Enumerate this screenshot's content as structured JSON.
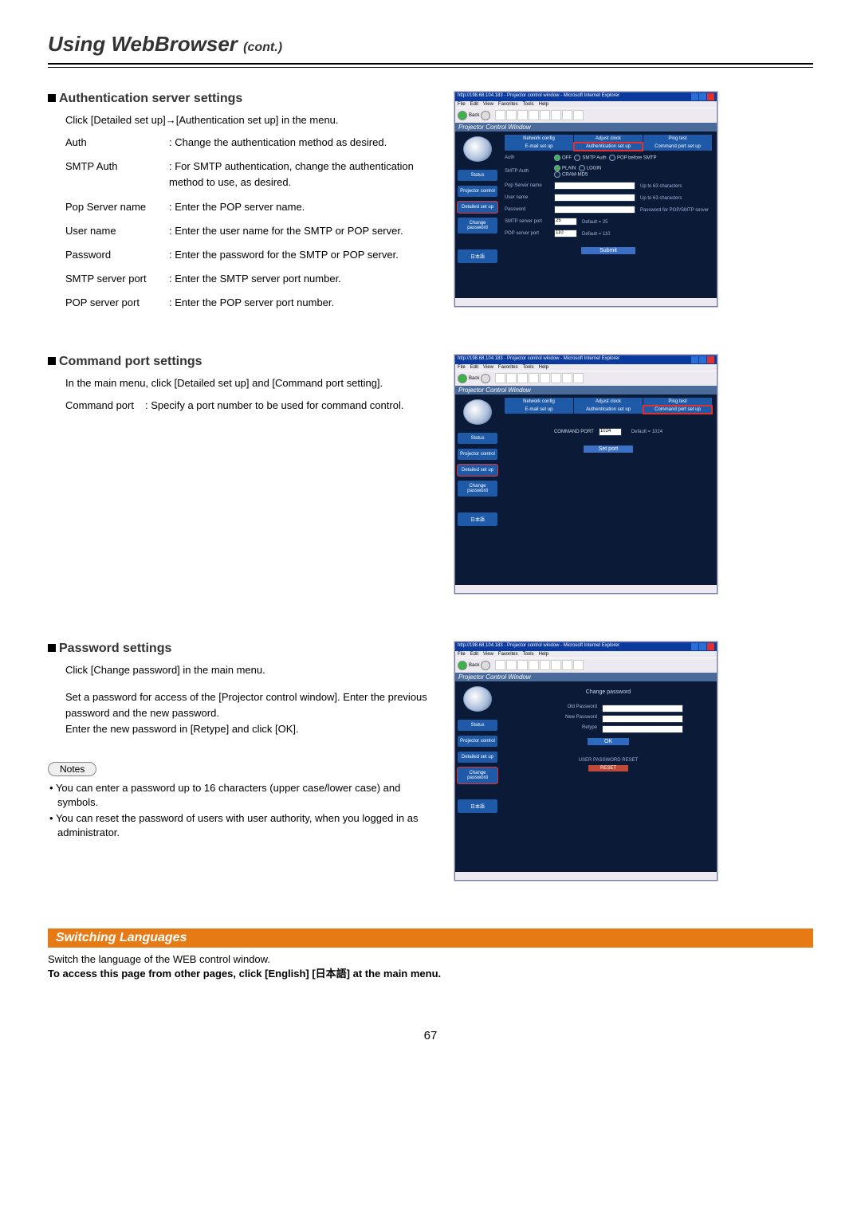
{
  "title": "Using WebBrowser",
  "title_cont": "(cont.)",
  "pagenum": "67",
  "s1": {
    "heading": "Authentication server settings",
    "intro1": "Click [Detailed set up]→[Authentication set up] in the menu.",
    "rows": [
      {
        "k": "Auth",
        "v": ": Change the authentication method as desired."
      },
      {
        "k": "SMTP Auth",
        "v": ": For SMTP authentication, change the authentication method to use, as desired."
      },
      {
        "k": "Pop Server name",
        "v": ": Enter the POP server name."
      },
      {
        "k": "User name",
        "v": ": Enter the user name for the SMTP or POP server."
      },
      {
        "k": "Password",
        "v": ": Enter the password for the SMTP or POP server."
      },
      {
        "k": "SMTP server port",
        "v": ": Enter the SMTP server port number."
      },
      {
        "k": "POP server port",
        "v": ": Enter the POP server port number."
      }
    ]
  },
  "s2": {
    "heading": "Command port settings",
    "intro": "In the main menu, click [Detailed set up] and [Command port setting].",
    "row_k": "Command port",
    "row_v": ": Specify a port number to be used for command control."
  },
  "s3": {
    "heading": "Password settings",
    "p1": "Click [Change password] in the main menu.",
    "p2": "Set a password for access of the [Projector control window]. Enter the previous password and the new password.",
    "p3": "Enter the new password in [Retype] and click [OK].",
    "notes_label": "Notes",
    "n1": "You can enter a password up to 16 characters (upper case/lower case) and symbols.",
    "n2": "You can reset the password of users with user authority, when you logged in as administrator."
  },
  "sw": {
    "bar": "Switching Languages",
    "p1": "Switch the language of the WEB control window.",
    "p2": "To access this page from other pages, click [English] [日本語] at the main menu."
  },
  "ss": {
    "titlebar": "http://198.68.104.183 - Projector control window - Microsoft Internet Explorer",
    "menu": {
      "file": "File",
      "edit": "Edit",
      "view": "View",
      "fav": "Favorites",
      "tools": "Tools",
      "help": "Help"
    },
    "tbar": {
      "back": "Back"
    },
    "pcw": "Projector Control Window",
    "tabs": {
      "nc": "Network config",
      "ac": "Adjust clock",
      "pt": "Ping test",
      "es": "E-mail set up",
      "au": "Authentication set up",
      "cp": "Command port set up"
    },
    "side": {
      "status": "Status",
      "proj": "Projector control",
      "det": "Detailed set up",
      "chg": "Change password",
      "lang": "日本語"
    },
    "auth": {
      "k_auth": "Auth",
      "r_off": "OFF",
      "r_smtp": "SMTP Auth",
      "r_pop": "POP before SMTP",
      "k_smtp": "SMTP Auth",
      "opt_plain": "PLAIN",
      "opt_login": "LOGIN",
      "opt_cram": "CRAM-MD5",
      "k_pops": "Pop Server name",
      "h_pops": "Up to 63 characters",
      "k_un": "User name",
      "h_un": "Up to 63 characters",
      "k_pw": "Password",
      "h_pw": "Password for POP/SMTP server",
      "k_sp": "SMTP server port",
      "v_sp": "25",
      "h_sp": "Default = 25",
      "k_pp": "POP server port",
      "v_pp": "110",
      "h_pp": "Default = 110",
      "submit": "Submit"
    },
    "cmd": {
      "lbl": "COMMAND PORT",
      "val": "1024",
      "hint": "Default = 1024",
      "set": "Set port"
    },
    "pw": {
      "title": "Change password",
      "old": "Old Password",
      "new": "New Password",
      "retype": "Retype",
      "ok": "OK",
      "upr": "USER PASSWORD RESET",
      "reset": "RESET"
    }
  }
}
